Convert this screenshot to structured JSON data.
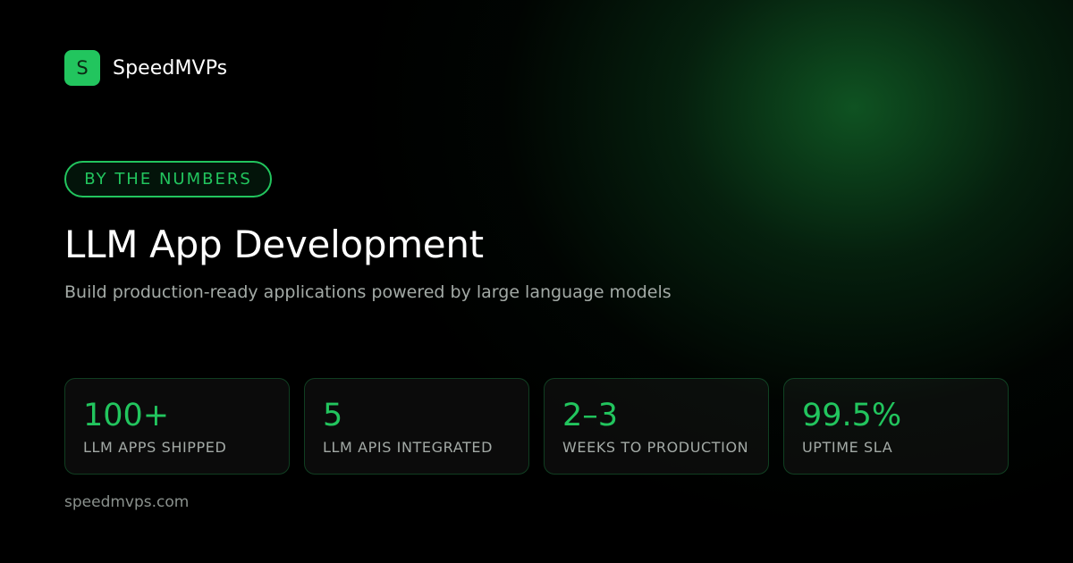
{
  "brand": {
    "logo_letter": "S",
    "name": "SpeedMVPs"
  },
  "badge": {
    "label": "BY THE NUMBERS"
  },
  "headline": "LLM App Development",
  "subtitle": "Build production-ready applications powered by large language models",
  "stats": [
    {
      "value": "100+",
      "label": "LLM APPS SHIPPED"
    },
    {
      "value": "5",
      "label": "LLM APIS INTEGRATED"
    },
    {
      "value": "2–3",
      "label": "WEEKS TO PRODUCTION"
    },
    {
      "value": "99.5%",
      "label": "UPTIME SLA"
    }
  ],
  "footer": {
    "url": "speedmvps.com"
  },
  "colors": {
    "accent": "#22c55e",
    "background": "#000000",
    "glow": "#146e2d",
    "text_primary": "#ffffff",
    "text_secondary": "#a3aaa6"
  }
}
